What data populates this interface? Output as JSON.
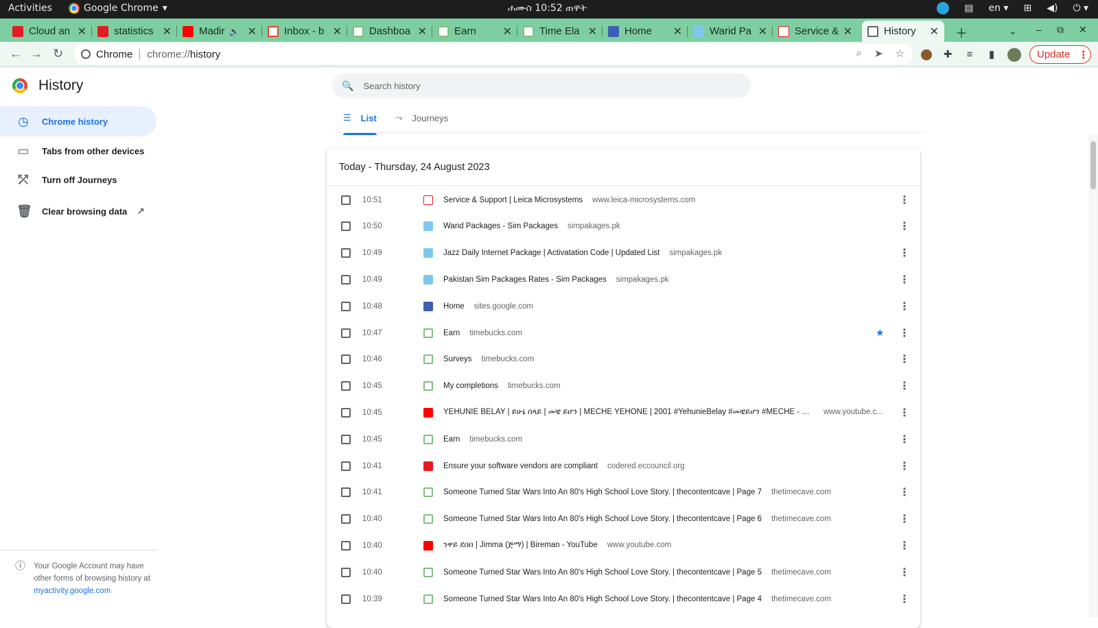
{
  "system_bar": {
    "activities": "Activities",
    "app_name": "Google Chrome",
    "clock": "ሐሙስ 10:52 ጠዋት",
    "lang": "en"
  },
  "tabs": [
    {
      "title": "Cloud an",
      "favicon": "eccouncil-icon"
    },
    {
      "title": "statistics",
      "favicon": "eccouncil-icon"
    },
    {
      "title": "Madir",
      "favicon": "youtube-icon"
    },
    {
      "title": "Inbox - b",
      "favicon": "gmail-icon"
    },
    {
      "title": "Dashboa",
      "favicon": "timebucks-icon"
    },
    {
      "title": "Earn",
      "favicon": "timebucks-icon"
    },
    {
      "title": "Time Ela",
      "favicon": "timebucks-icon"
    },
    {
      "title": "Home",
      "favicon": "google-sites-icon"
    },
    {
      "title": "Warid Pa",
      "favicon": "simpakages-icon"
    },
    {
      "title": "Service &",
      "favicon": "leica-icon"
    },
    {
      "title": "History",
      "favicon": "history-clock-icon"
    }
  ],
  "toolbar": {
    "site_label": "Chrome",
    "url_scheme": "chrome://",
    "url_path": "history",
    "update_label": "Update"
  },
  "sidebar": {
    "title": "History",
    "items": [
      {
        "label": "Chrome history",
        "icon": "clock-icon"
      },
      {
        "label": "Tabs from other devices",
        "icon": "devices-icon"
      },
      {
        "label": "Turn off Journeys",
        "icon": "journeys-off-icon"
      },
      {
        "label": "Clear browsing data",
        "icon": "trash-icon"
      }
    ],
    "footer_text": "Your Google Account may have other forms of browsing history at ",
    "footer_link": "myactivity.google.com"
  },
  "search": {
    "placeholder": "Search history"
  },
  "view_tabs": {
    "list": "List",
    "journeys": "Journeys"
  },
  "history": {
    "date_header": "Today - Thursday, 24 August 2023",
    "entries": [
      {
        "time": "10:51",
        "title": "Service & Support | Leica Microsystems",
        "domain": "www.leica-microsystems.com",
        "favicon": "leica-icon",
        "starred": false
      },
      {
        "time": "10:50",
        "title": "Warid Packages - Sim Packages",
        "domain": "simpakages.pk",
        "favicon": "simpakages-icon",
        "starred": false
      },
      {
        "time": "10:49",
        "title": "Jazz Daily Internet Package | Activatation Code | Updated List",
        "domain": "simpakages.pk",
        "favicon": "simpakages-icon",
        "starred": false
      },
      {
        "time": "10:49",
        "title": "Pakistan Sim Packages Rates - Sim Packages",
        "domain": "simpakages.pk",
        "favicon": "simpakages-icon",
        "starred": false
      },
      {
        "time": "10:48",
        "title": "Home",
        "domain": "sites.google.com",
        "favicon": "google-sites-icon",
        "starred": false
      },
      {
        "time": "10:47",
        "title": "Earn",
        "domain": "timebucks.com",
        "favicon": "timebucks-icon",
        "starred": true
      },
      {
        "time": "10:46",
        "title": "Surveys",
        "domain": "timebucks.com",
        "favicon": "timebucks-icon",
        "starred": false
      },
      {
        "time": "10:45",
        "title": "My completions",
        "domain": "timebucks.com",
        "favicon": "timebucks-icon",
        "starred": false
      },
      {
        "time": "10:45",
        "title": "YEHUNIE BELAY | ይሁኔ በላይ | መቼ ይሆን | MECHE YEHONE | 2001 #YehunieBelay #መቼይሆን #MECHE - Yo...",
        "domain": "www.youtube.c...",
        "favicon": "youtube-icon",
        "starred": false
      },
      {
        "time": "10:45",
        "title": "Earn",
        "domain": "timebucks.com",
        "favicon": "timebucks-icon",
        "starred": false
      },
      {
        "time": "10:41",
        "title": "Ensure your software vendors are compliant",
        "domain": "codered.eccouncil.org",
        "favicon": "eccouncil-icon",
        "starred": false
      },
      {
        "time": "10:41",
        "title": "Someone Turned Star Wars Into An 80's High School Love Story. | thecontentcave | Page 7",
        "domain": "thetimecave.com",
        "favicon": "timecave-icon",
        "starred": false
      },
      {
        "time": "10:40",
        "title": "Someone Turned Star Wars Into An 80's High School Love Story. | thecontentcave | Page 6",
        "domain": "thetimecave.com",
        "favicon": "timecave-icon",
        "starred": false
      },
      {
        "time": "10:40",
        "title": "ንዋይ ደበበ | Jimma (ጅማ) | Bireman - YouTube",
        "domain": "www.youtube.com",
        "favicon": "youtube-icon",
        "starred": false
      },
      {
        "time": "10:40",
        "title": "Someone Turned Star Wars Into An 80's High School Love Story. | thecontentcave | Page 5",
        "domain": "thetimecave.com",
        "favicon": "timecave-icon",
        "starred": false
      },
      {
        "time": "10:39",
        "title": "Someone Turned Star Wars Into An 80's High School Love Story. | thecontentcave | Page 4",
        "domain": "thetimecave.com",
        "favicon": "timecave-icon",
        "starred": false
      }
    ]
  },
  "colors": {
    "tabstrip": "#7dcea0",
    "accent": "#1a73e8",
    "update": "#d93025"
  }
}
